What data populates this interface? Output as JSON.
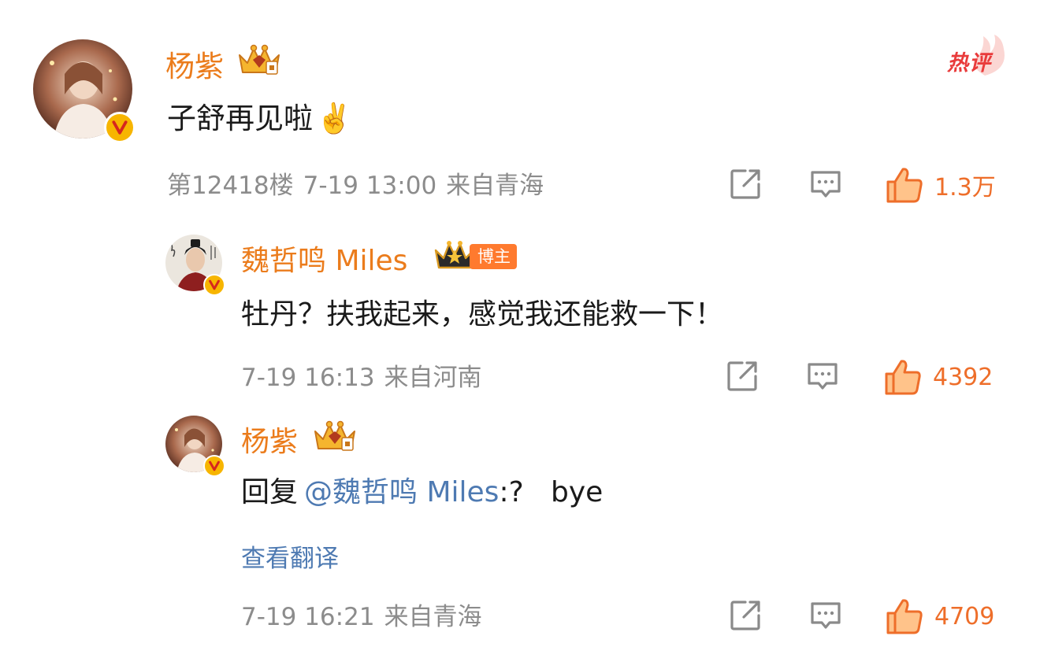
{
  "hot_tag": "热评",
  "main_comment": {
    "username": "杨紫",
    "text": "子舒再见啦",
    "emoji": "✌️",
    "floor": "第12418楼",
    "time": "7-19 13:00",
    "location": "来自青海",
    "likes": "1.3万"
  },
  "replies": [
    {
      "username": "魏哲鸣 Miles",
      "badge": "博主",
      "text": "牡丹？扶我起来，感觉我还能救一下！",
      "time": "7-19 16:13",
      "location": "来自河南",
      "likes": "4392"
    },
    {
      "username": "杨紫",
      "reply_prefix": "回复",
      "mention": "@魏哲鸣 Miles",
      "reply_suffix": ":?   bye",
      "translate_label": "查看翻译",
      "time": "7-19 16:21",
      "location": "来自青海",
      "likes": "4709"
    }
  ],
  "colors": {
    "username": "#eb7c1c",
    "meta": "#8c8c8c",
    "like": "#ee6e2a",
    "mention": "#4e7ab2",
    "hot_tag": "#e93b3b",
    "badge": "#ff7a2e"
  }
}
